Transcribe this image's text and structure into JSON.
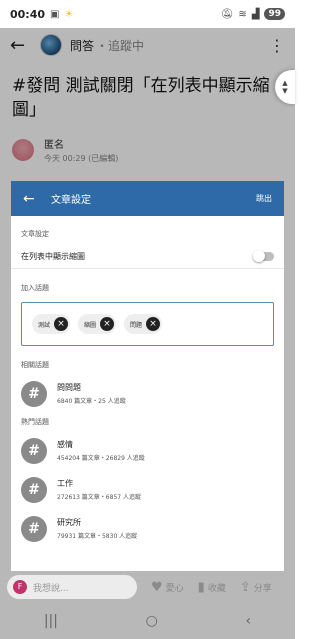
{
  "status": {
    "time": "00:40",
    "battery": "99"
  },
  "appbar": {
    "forum": "問答",
    "forum_sub": "・追蹤中"
  },
  "post": {
    "title": "#發問 測試關閉「在列表中顯示縮圖」",
    "author": "匿名",
    "time": "今天 00:29 (已編輯)"
  },
  "panel": {
    "title": "文章設定",
    "skip": "跳出",
    "settings_label": "文章設定",
    "thumbnail_label": "在列表中顯示縮圖",
    "thumbnail_enabled": false,
    "add_topic_label": "加入話題",
    "tags": [
      "測試",
      "縮圖",
      "問題"
    ],
    "related_label": "相關話題",
    "related": [
      {
        "name": "問問題",
        "stat": "6840 篇文章・25 人追蹤"
      }
    ],
    "popular_label": "熱門話題",
    "popular": [
      {
        "name": "感情",
        "stat": "454204 篇文章・26829 人追蹤"
      },
      {
        "name": "工作",
        "stat": "272613 篇文章・6857 人追蹤"
      },
      {
        "name": "研究所",
        "stat": "79931 篇文章・5830 人追蹤"
      }
    ]
  },
  "bottom": {
    "avatar_letter": "F",
    "reply_placeholder": "我想說...",
    "like": "愛心",
    "save": "收藏",
    "share": "分享"
  },
  "icons": {
    "back": "arrow-left-icon",
    "more": "more-vertical-icon",
    "close_chip": "close-circle-icon",
    "hash": "hashtag-icon",
    "heart": "heart-icon",
    "bookmark": "bookmark-icon",
    "share": "share-icon"
  },
  "colors": {
    "panel_header": "#2f6aa8",
    "tag_border": "#5a8fa8",
    "reply_avatar": "#c0336b"
  }
}
